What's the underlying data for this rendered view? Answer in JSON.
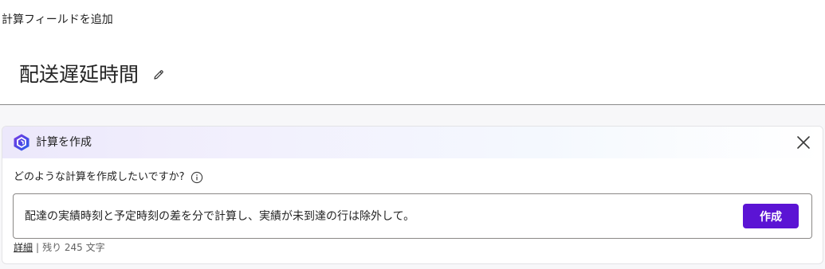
{
  "dialog": {
    "heading": "計算フィールドを追加",
    "field_name": "配送遅延時間"
  },
  "copilot": {
    "title": "計算を作成",
    "question": "どのような計算を作成したいですか?",
    "prompt_value": "配達の実績時刻と予定時刻の差を分で計算し、実績が未到達の行は除外して。",
    "create_label": "作成",
    "details_label": "詳細",
    "separator": "|",
    "remaining_label": "残り 245 文字",
    "remaining_count": 245
  },
  "icons": {
    "edit": "pencil-icon",
    "copilot": "copilot-logo-icon",
    "close": "close-icon",
    "info": "info-icon"
  },
  "colors": {
    "accent": "#5b14d4",
    "divider": "#8a8a8a",
    "header_gradient_start": "#ece8fb"
  }
}
